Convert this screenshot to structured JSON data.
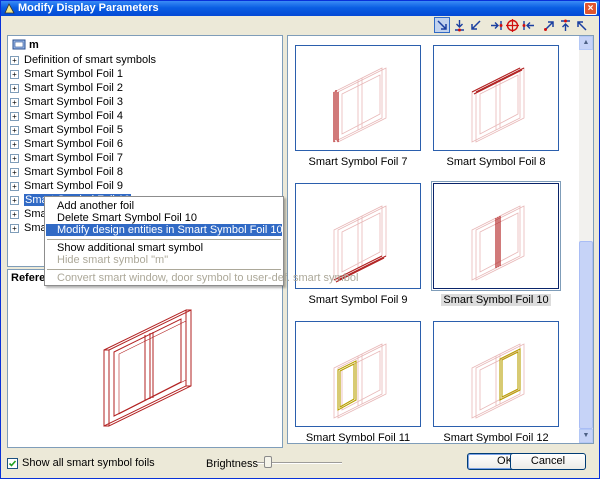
{
  "window": {
    "title": "Modify Display Parameters",
    "close_label": "×"
  },
  "toolbar": {
    "buttons": [
      {
        "icon": "arrow-down-right-icon"
      },
      {
        "icon": "arrow-down-stop-icon"
      },
      {
        "icon": "arrow-down-left-icon"
      },
      {
        "icon": "arrow-right-stop-icon"
      },
      {
        "icon": "target-icon"
      },
      {
        "icon": "arrow-left-stop-icon"
      },
      {
        "icon": "arrow-up-right-icon"
      },
      {
        "icon": "arrow-up-stop-icon"
      },
      {
        "icon": "arrow-up-left-icon"
      }
    ]
  },
  "tree": {
    "root_label": "m",
    "items": [
      "Definition of smart symbols",
      "Smart Symbol Foil 1",
      "Smart Symbol Foil 2",
      "Smart Symbol Foil 3",
      "Smart Symbol Foil 4",
      "Smart Symbol Foil 5",
      "Smart Symbol Foil 6",
      "Smart Symbol Foil 7",
      "Smart Symbol Foil 8",
      "Smart Symbol Foil 9",
      "Smart Symbol Foil 10",
      "Smart",
      "Smart"
    ],
    "selected_index": 10
  },
  "context_menu": {
    "items": [
      "Add another foil",
      "Delete Smart Symbol Foil 10",
      "Modify design entities in Smart Symbol Foil 10",
      "Show additional smart symbol",
      "Hide smart symbol \"m\"",
      "Convert smart window, door symbol to user-def. smart symbol"
    ]
  },
  "reference": {
    "title": "Referen"
  },
  "gallery": {
    "tiles": [
      "Smart Symbol Foil 7",
      "Smart Symbol Foil 8",
      "Smart Symbol Foil 9",
      "Smart Symbol Foil 10",
      "Smart Symbol Foil 11",
      "Smart Symbol Foil 12"
    ],
    "selected_index": 3
  },
  "bottom": {
    "show_all_label": "Show all smart symbol foils",
    "show_all_checked": true,
    "brightness_label": "Brightness",
    "brightness_level": 0.1,
    "ok_label": "OK",
    "cancel_label": "Cancel"
  },
  "colors": {
    "title_bar": "#0a5ee3",
    "selection": "#316ac5",
    "wireframe_faint": "#e8b8b8",
    "wireframe_highlight": "#b22222",
    "wireframe_yellow": "#b8a000"
  }
}
